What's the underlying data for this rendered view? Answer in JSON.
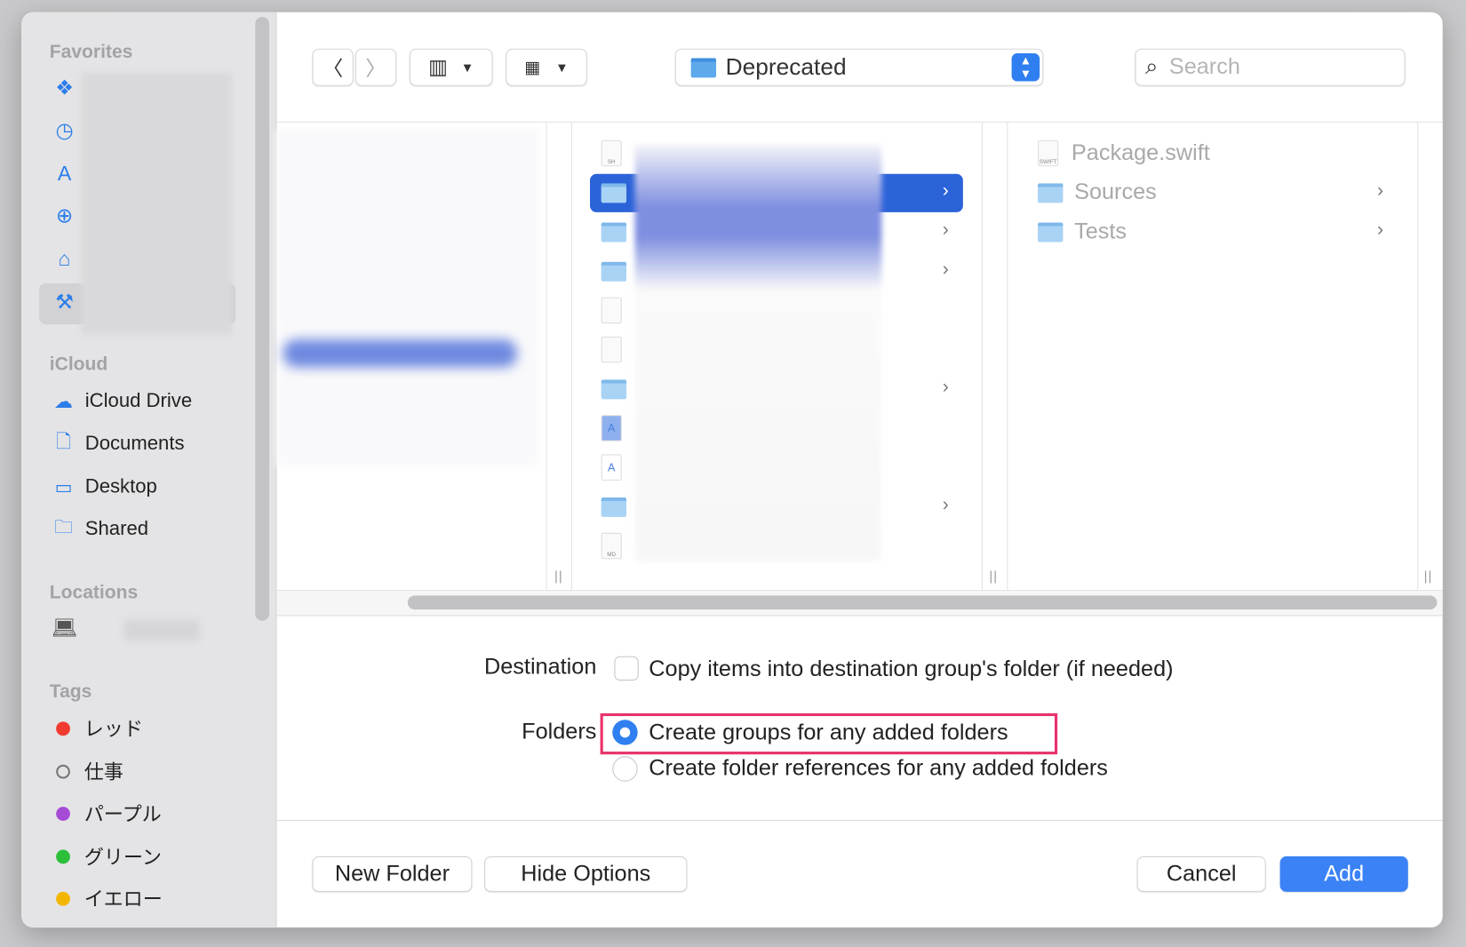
{
  "sidebar": {
    "favorites_label": "Favorites",
    "favorites_icons": [
      "dropbox-icon",
      "recents-clock-icon",
      "applications-icon",
      "downloads-icon",
      "home-icon",
      "developer-hammer-icon"
    ],
    "icloud_label": "iCloud",
    "icloud_items": [
      {
        "label": "iCloud Drive",
        "icon": "cloud-icon"
      },
      {
        "label": "Documents",
        "icon": "document-icon"
      },
      {
        "label": "Desktop",
        "icon": "desktop-icon"
      },
      {
        "label": "Shared",
        "icon": "shared-folder-icon"
      }
    ],
    "locations_label": "Locations",
    "locations_icons": [
      "laptop-icon"
    ],
    "tags_label": "Tags",
    "tags": [
      {
        "label": "レッド",
        "color": "#f23b30"
      },
      {
        "label": "仕事",
        "color": "outline"
      },
      {
        "label": "パープル",
        "color": "#a64bd6"
      },
      {
        "label": "グリーン",
        "color": "#2cbf3a"
      },
      {
        "label": "イエロー",
        "color": "#f2b600"
      }
    ]
  },
  "toolbar": {
    "path_popup": "Deprecated",
    "search_placeholder": "Search"
  },
  "browser": {
    "column2_icons": [
      "sh-file",
      "folder",
      "folder",
      "folder",
      "file",
      "text-file",
      "folder",
      "app-document",
      "app-document",
      "folder",
      "md-file"
    ],
    "column3_items": [
      {
        "label": "Package.swift",
        "type": "file"
      },
      {
        "label": "Sources",
        "type": "folder"
      },
      {
        "label": "Tests",
        "type": "folder"
      }
    ]
  },
  "options": {
    "destination_label": "Destination",
    "copy_items_label": "Copy items into destination group's folder (if needed)",
    "copy_items_checked": false,
    "folders_label": "Folders",
    "create_groups_label": "Create groups for any added folders",
    "create_references_label": "Create folder references for any added folders",
    "selected_option": "Create groups for any added folders",
    "highlight_color": "#e8336b"
  },
  "buttons": {
    "new_folder": "New Folder",
    "hide_options": "Hide Options",
    "cancel": "Cancel",
    "add": "Add"
  },
  "colors": {
    "accent": "#3b82f6",
    "selection": "#2b63d9"
  }
}
